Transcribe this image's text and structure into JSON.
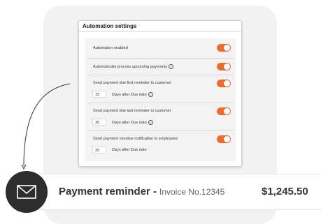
{
  "settings": {
    "title": "Automation settings",
    "rows": [
      {
        "label": "Automation enabled",
        "info": false,
        "enabled": true
      },
      {
        "label": "Automatically process upcoming payments",
        "info": true,
        "enabled": true
      },
      {
        "label": "Send payment due first reminder to customer",
        "info": false,
        "enabled": true,
        "days_value": "15",
        "days_label": "Days after Due date",
        "days_info": true
      },
      {
        "label": "Send payment due last reminder to customer",
        "info": false,
        "enabled": true,
        "days_value": "30",
        "days_label": "Days after Due date",
        "days_info": true
      },
      {
        "label": "Send payment overdue notification to employees",
        "info": false,
        "enabled": true,
        "days_value": "35",
        "days_label": "Days after Due date",
        "days_info": false
      }
    ],
    "info_glyph": "i"
  },
  "reminder": {
    "title": "Payment reminder -",
    "invoice": "Invoice No.12345",
    "amount": "$1,245.50",
    "icon": "envelope-icon"
  },
  "colors": {
    "toggle_on": "#ea6a30",
    "mail_circle": "#2d2d2d",
    "card_bg": "#f2f2f2"
  }
}
